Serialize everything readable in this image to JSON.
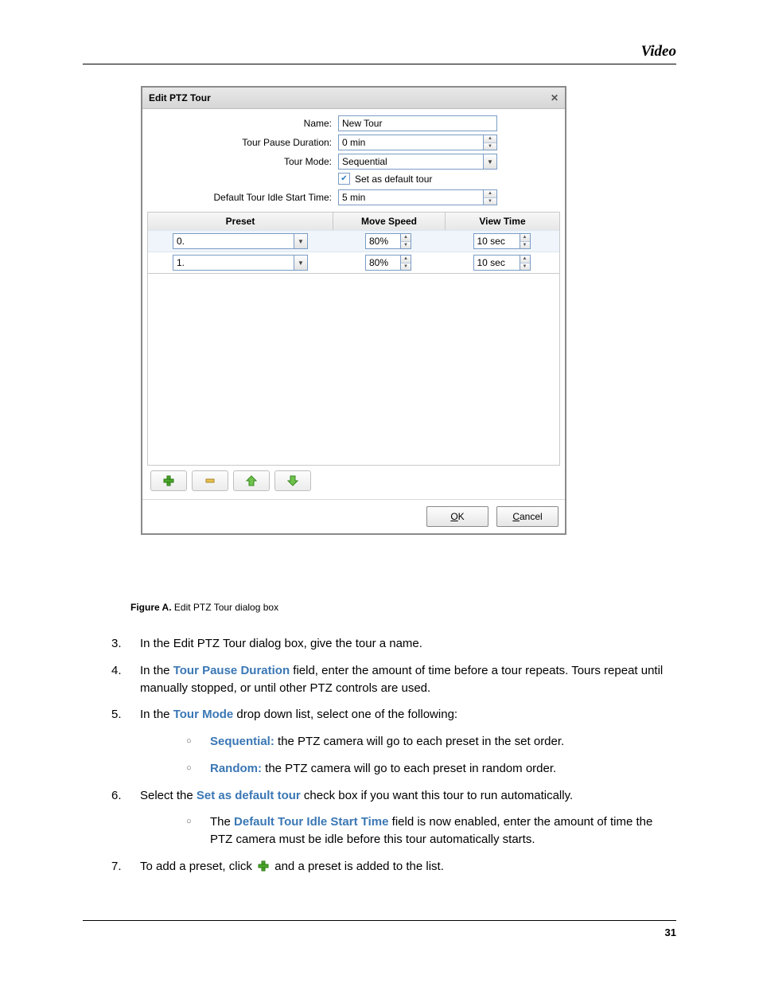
{
  "header": {
    "section": "Video"
  },
  "footer": {
    "page": "31"
  },
  "dialog": {
    "title": "Edit PTZ Tour",
    "labels": {
      "name": "Name:",
      "pause": "Tour Pause Duration:",
      "mode": "Tour Mode:",
      "default_chk": "Set as default tour",
      "idle": "Default Tour Idle Start Time:"
    },
    "values": {
      "name": "New Tour",
      "pause": "0 min",
      "mode": "Sequential",
      "default_checked": true,
      "idle": "5 min"
    },
    "columns": {
      "preset": "Preset",
      "speed": "Move Speed",
      "view": "View Time"
    },
    "rows": [
      {
        "preset": "0.",
        "speed": "80%",
        "view": "10 sec"
      },
      {
        "preset": "1.",
        "speed": "80%",
        "view": "10 sec"
      }
    ],
    "buttons": {
      "ok_u": "O",
      "ok_r": "K",
      "cancel_u": "C",
      "cancel_r": "ancel"
    }
  },
  "caption": {
    "lead": "Figure A.",
    "text": " Edit PTZ Tour dialog box"
  },
  "steps": {
    "s3": {
      "n": "3.",
      "text": "In the Edit PTZ Tour dialog box, give the tour a name."
    },
    "s4": {
      "n": "4.",
      "pre": "In the ",
      "term": "Tour Pause Duration",
      "post": " field, enter the amount of time before a tour repeats. Tours repeat until manually stopped, or until other PTZ controls are used."
    },
    "s5": {
      "n": "5.",
      "pre": "In the ",
      "term": "Tour Mode",
      "post": " drop down list, select one of the following:"
    },
    "s5a": {
      "term": "Sequential:",
      "text": " the PTZ camera will go to each preset in the set order."
    },
    "s5b": {
      "term": "Random:",
      "text": " the PTZ camera will go to each preset in random order."
    },
    "s6": {
      "n": "6.",
      "pre": "Select the ",
      "term": "Set as default tour",
      "post": " check box if you want this tour to run automatically."
    },
    "s6a": {
      "pre": "The ",
      "term": "Default Tour Idle Start Time",
      "post": " field is now enabled, enter the amount of time the PTZ camera must be idle before this tour automatically starts."
    },
    "s7": {
      "n": "7.",
      "pre": "To add a preset, click ",
      "post": "  and a preset is added to the list."
    }
  }
}
